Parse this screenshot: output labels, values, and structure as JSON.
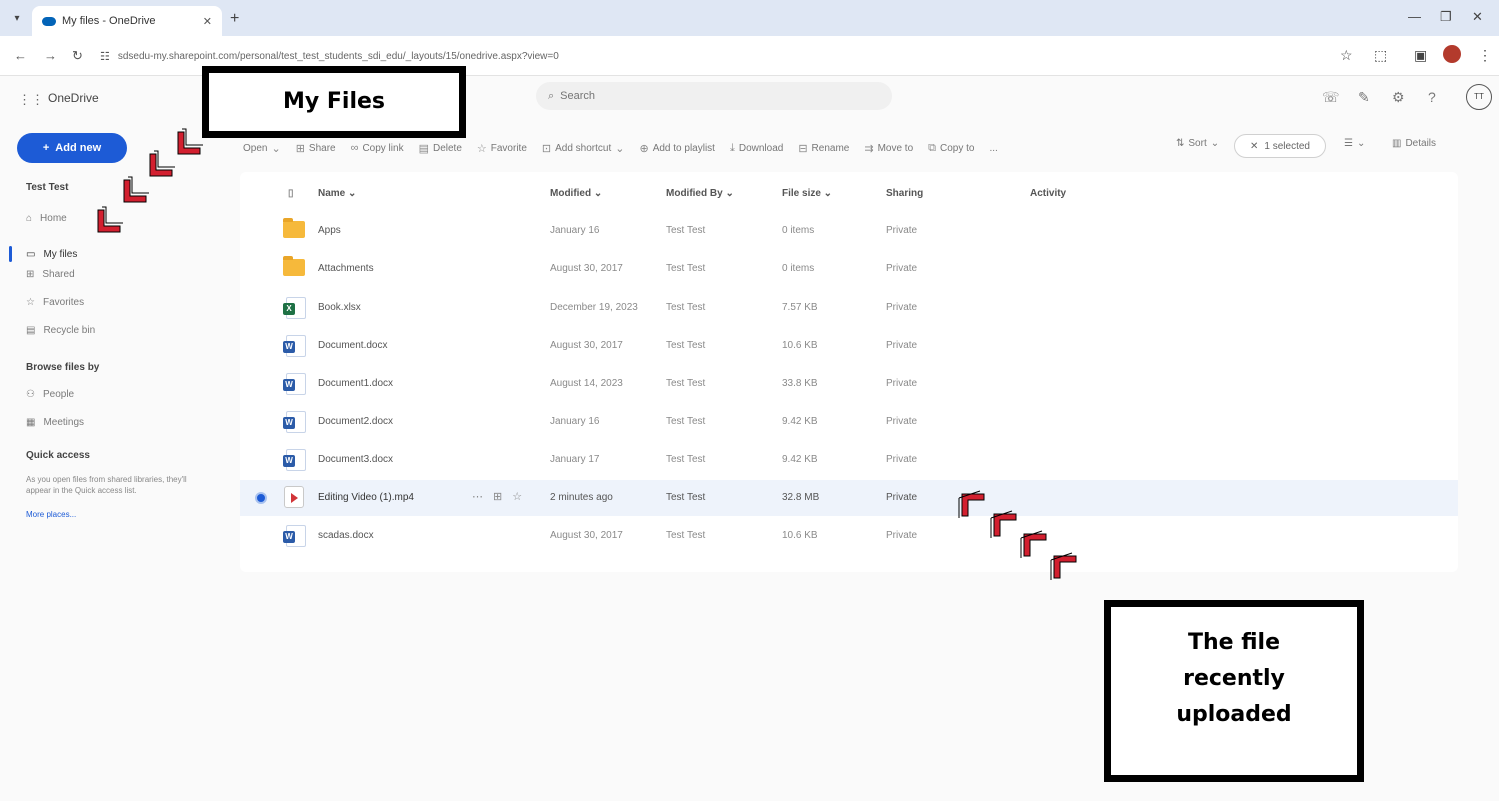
{
  "browser": {
    "tab_title": "My files - OneDrive",
    "url": "sdsedu-my.sharepoint.com/personal/test_test_students_sdi_edu/_layouts/15/onedrive.aspx?view=0"
  },
  "app": {
    "name": "OneDrive",
    "search_placeholder": "Search",
    "avatar_initials": "TT"
  },
  "sidebar": {
    "add_new_label": "Add new",
    "user_name": "Test Test",
    "nav": [
      {
        "label": "Home",
        "icon": "home-icon"
      },
      {
        "label": "My files",
        "icon": "folder-icon"
      },
      {
        "label": "Shared",
        "icon": "shared-icon"
      },
      {
        "label": "Favorites",
        "icon": "star-icon"
      },
      {
        "label": "Recycle bin",
        "icon": "trash-icon"
      }
    ],
    "browse_heading": "Browse files by",
    "browse": [
      {
        "label": "People",
        "icon": "people-icon"
      },
      {
        "label": "Meetings",
        "icon": "calendar-icon"
      }
    ],
    "quick_access_heading": "Quick access",
    "quick_access_note": "As you open files from shared libraries, they'll appear in the Quick access list.",
    "more_places": "More places..."
  },
  "commandbar": {
    "open": "Open",
    "share": "Share",
    "copy_link": "Copy link",
    "delete": "Delete",
    "favorite": "Favorite",
    "add_shortcut": "Add shortcut",
    "add_to_playlist": "Add to playlist",
    "download": "Download",
    "rename": "Rename",
    "move_to": "Move to",
    "copy_to": "Copy to",
    "more": "...",
    "sort": "Sort",
    "selected": "1 selected",
    "details": "Details"
  },
  "table": {
    "columns": {
      "name": "Name",
      "modified": "Modified",
      "modified_by": "Modified By",
      "file_size": "File size",
      "sharing": "Sharing",
      "activity": "Activity"
    },
    "rows": [
      {
        "type": "folder",
        "name": "Apps",
        "modified": "January 16",
        "modified_by": "Test Test",
        "size": "0 items",
        "sharing": "Private"
      },
      {
        "type": "folder",
        "name": "Attachments",
        "modified": "August 30, 2017",
        "modified_by": "Test Test",
        "size": "0 items",
        "sharing": "Private"
      },
      {
        "type": "excel",
        "name": "Book.xlsx",
        "modified": "December 19, 2023",
        "modified_by": "Test Test",
        "size": "7.57 KB",
        "sharing": "Private"
      },
      {
        "type": "word",
        "name": "Document.docx",
        "modified": "August 30, 2017",
        "modified_by": "Test Test",
        "size": "10.6 KB",
        "sharing": "Private"
      },
      {
        "type": "word",
        "name": "Document1.docx",
        "modified": "August 14, 2023",
        "modified_by": "Test Test",
        "size": "33.8 KB",
        "sharing": "Private"
      },
      {
        "type": "word",
        "name": "Document2.docx",
        "modified": "January 16",
        "modified_by": "Test Test",
        "size": "9.42 KB",
        "sharing": "Private"
      },
      {
        "type": "word",
        "name": "Document3.docx",
        "modified": "January 17",
        "modified_by": "Test Test",
        "size": "9.42 KB",
        "sharing": "Private"
      },
      {
        "type": "video",
        "name": "Editing Video (1).mp4",
        "modified": "2 minutes ago",
        "modified_by": "Test Test",
        "size": "32.8 MB",
        "sharing": "Private"
      },
      {
        "type": "word",
        "name": "scadas.docx",
        "modified": "August 30, 2017",
        "modified_by": "Test Test",
        "size": "10.6 KB",
        "sharing": "Private"
      }
    ]
  },
  "annotations": {
    "my_files": "My Files",
    "recent_line1": "The file",
    "recent_line2": "recently",
    "recent_line3": "uploaded",
    "accent_color": "#d21f2f"
  }
}
